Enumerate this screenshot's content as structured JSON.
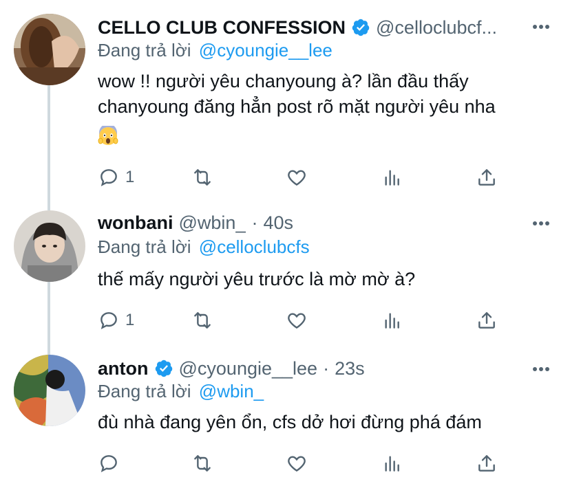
{
  "tweets": [
    {
      "name": "CELLO CLUB CONFESSION",
      "verified": true,
      "handle": "@celloclubcf...",
      "replying_label": "Đang trả lời",
      "replying_to": "@cyoungie__lee",
      "text_line1": "wow !! người yêu chanyoung à? lần đầu thấy",
      "text_line2": "chanyoung đăng hẳn post rõ mặt người yêu nha",
      "emoji": "scream-emoji",
      "reply_count": "1"
    },
    {
      "name": "wonbani",
      "verified": false,
      "handle": "@wbin_",
      "dot": "·",
      "time": "40s",
      "replying_label": "Đang trả lời",
      "replying_to": "@celloclubcfs",
      "text": "thế mấy người yêu trước là mờ mờ à?",
      "reply_count": "1"
    },
    {
      "name": "anton",
      "verified": true,
      "handle": "@cyoungie__lee",
      "dot": "·",
      "time": "23s",
      "replying_label": "Đang trả lời",
      "replying_to": "@wbin_",
      "text": "đù nhà đang yên ổn, cfs dở hơi đừng phá đám",
      "reply_count": ""
    }
  ],
  "colors": {
    "accent": "#1d9bf0",
    "muted": "#536471",
    "text": "#0f1419",
    "thread_line": "#cfd9de"
  }
}
